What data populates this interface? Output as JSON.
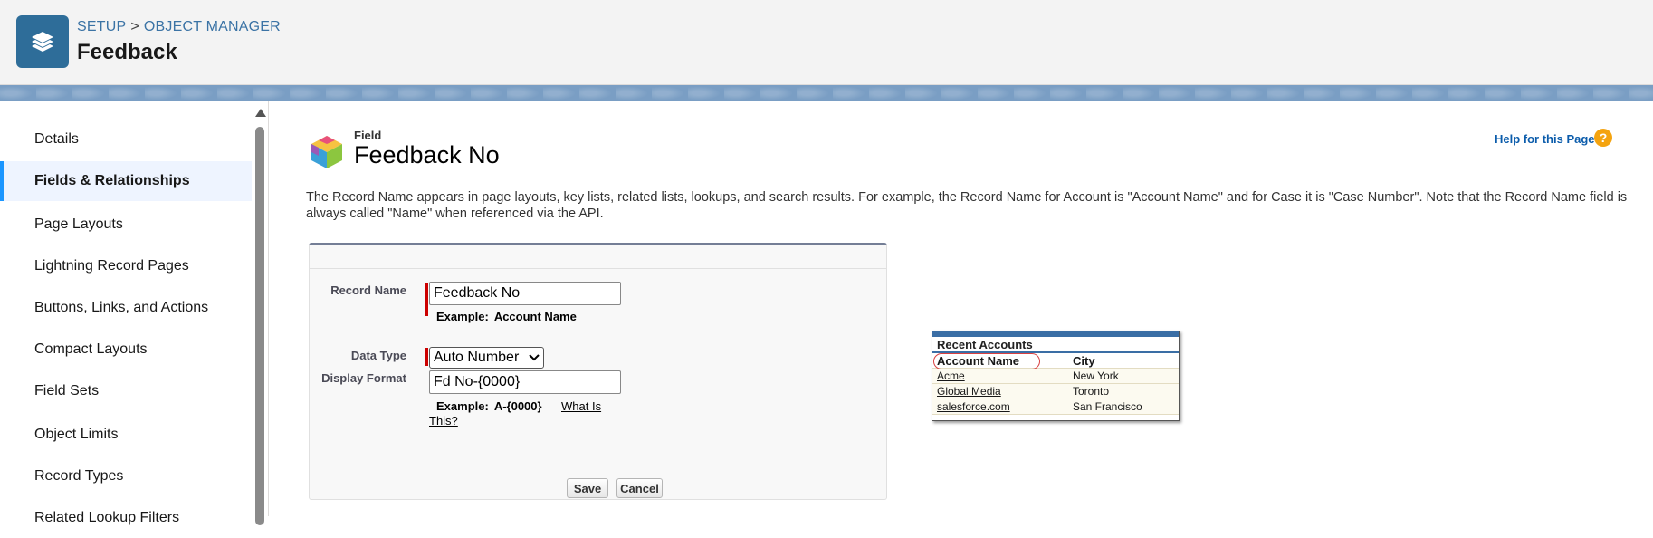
{
  "header": {
    "breadcrumb": [
      "SETUP",
      "OBJECT MANAGER"
    ],
    "breadcrumb_separator": ">",
    "title": "Feedback",
    "icon": "layers-icon",
    "accent_color": "#2e6d99"
  },
  "sidebar": {
    "items": [
      {
        "label": "Details",
        "active": false
      },
      {
        "label": "Fields & Relationships",
        "active": true
      },
      {
        "label": "Page Layouts",
        "active": false
      },
      {
        "label": "Lightning Record Pages",
        "active": false
      },
      {
        "label": "Buttons, Links, and Actions",
        "active": false
      },
      {
        "label": "Compact Layouts",
        "active": false
      },
      {
        "label": "Field Sets",
        "active": false
      },
      {
        "label": "Object Limits",
        "active": false
      },
      {
        "label": "Record Types",
        "active": false
      },
      {
        "label": "Related Lookup Filters",
        "active": false
      }
    ]
  },
  "main": {
    "field_label": "Field",
    "field_title": "Feedback No",
    "help_link": "Help for this Page",
    "help_icon": "question-icon",
    "description": "The Record Name appears in page layouts, key lists, related lists, lookups, and search results. For example, the Record Name for Account is \"Account Name\" and for Case it is \"Case Number\". Note that the Record Name field is always called \"Name\" when referenced via the API."
  },
  "form": {
    "record_name_label": "Record Name",
    "record_name_value": "Feedback No",
    "record_name_example_label": "Example:",
    "record_name_example_value": "Account Name",
    "data_type_label": "Data Type",
    "data_type_value": "Auto Number",
    "display_format_label": "Display Format",
    "display_format_value": "Fd No-{0000}",
    "display_format_example_label": "Example:",
    "display_format_example_value": "A-{0000}",
    "what_is_this_link": "What Is This?",
    "save_label": "Save",
    "cancel_label": "Cancel"
  },
  "sample": {
    "title": "Recent Accounts",
    "columns": [
      "Account Name",
      "City"
    ],
    "rows": [
      [
        "Acme",
        "New York"
      ],
      [
        "Global Media",
        "Toronto"
      ],
      [
        "salesforce.com",
        "San Francisco"
      ]
    ]
  }
}
